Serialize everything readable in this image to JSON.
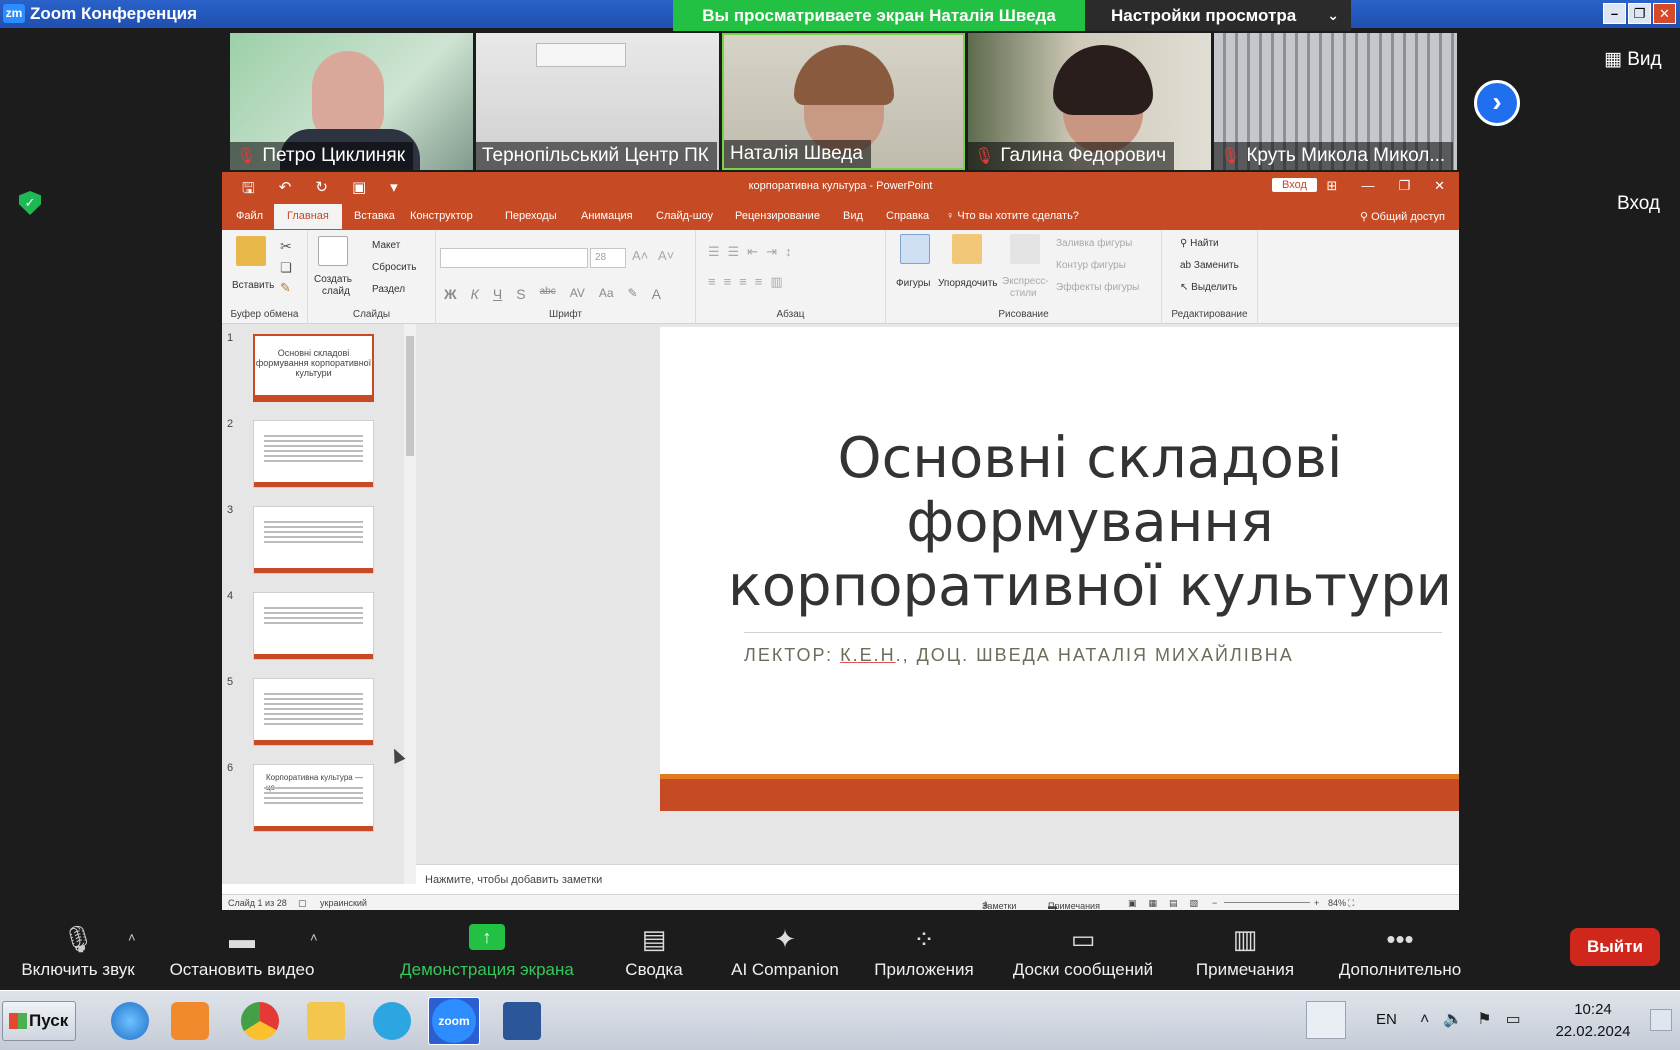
{
  "zoom": {
    "app_title": "Zoom Конференция",
    "logo_text": "zm",
    "viewing_banner": "Вы просматриваете экран Наталія Шведа",
    "view_options": "Настройки просмотра",
    "view_button": "Вид",
    "login_right": "Вход",
    "participants": [
      {
        "name": "Петро Циклиняк",
        "muted": true
      },
      {
        "name": "Тернопільський Центр ПК",
        "muted": false
      },
      {
        "name": "Наталія Шведа",
        "muted": false
      },
      {
        "name": "Галина Федорович",
        "muted": true
      },
      {
        "name": "Круть Микола Микол...",
        "muted": true
      }
    ],
    "toolbar": {
      "mute": "Включить звук",
      "video": "Остановить видео",
      "share": "Демонстрация экрана",
      "summary": "Сводка",
      "ai": "AI Companion",
      "apps": "Приложения",
      "boards": "Доски сообщений",
      "notes": "Примечания",
      "more": "Дополнительно",
      "leave": "Выйти"
    }
  },
  "ppt": {
    "title": "корпоративна культура  -  PowerPoint",
    "login": "Вход",
    "tabs": [
      "Файл",
      "Главная",
      "Вставка",
      "Конструктор",
      "Переходы",
      "Анимация",
      "Слайд-шоу",
      "Рецензирование",
      "Вид",
      "Справка"
    ],
    "tell_me": "Что вы хотите сделать?",
    "share": "Общий доступ",
    "ribbon": {
      "clipboard": {
        "label": "Буфер обмена",
        "paste": "Вставить"
      },
      "slides": {
        "label": "Слайды",
        "new_slide_1": "Создать",
        "new_slide_2": "слайд",
        "layout": "Макет",
        "reset": "Сбросить",
        "section": "Раздел"
      },
      "font": {
        "label": "Шрифт",
        "size": "28",
        "bold": "Ж",
        "italic": "К",
        "underline": "Ч",
        "strike": "S",
        "strike2": "abc",
        "spacing": "AV",
        "case": "Aa",
        "color": "A"
      },
      "paragraph": {
        "label": "Абзац"
      },
      "drawing": {
        "label": "Рисование",
        "shapes": "Фигуры",
        "arrange": "Упорядочить",
        "styles_1": "Экспресс-",
        "styles_2": "стили",
        "fill": "Заливка фигуры",
        "outline": "Контур фигуры",
        "effects": "Эффекты фигуры"
      },
      "editing": {
        "label": "Редактирование",
        "find": "Найти",
        "replace": "Заменить",
        "select": "Выделить"
      }
    },
    "slides": [
      {
        "num": "1",
        "title": "Основні складові формування корпоративної культури"
      },
      {
        "num": "2"
      },
      {
        "num": "3"
      },
      {
        "num": "4"
      },
      {
        "num": "5"
      },
      {
        "num": "6",
        "title": "Корпоративна культура — це"
      }
    ],
    "current_slide": {
      "title": "Основні складові формування корпоративної культури",
      "sub_prefix": "ЛЕКТОР: ",
      "sub_underlined": "К.Е.Н",
      "sub_rest": "., ДОЦ. ШВЕДА НАТАЛІЯ МИХАЙЛІВНА"
    },
    "notes_placeholder": "Нажмите, чтобы добавить заметки",
    "status": {
      "slide_of": "Слайд 1 из 28",
      "language": "украинский",
      "notes": "Заметки",
      "comments": "Примечания",
      "zoom": "84%"
    }
  },
  "taskbar": {
    "start": "Пуск",
    "lang": "EN",
    "time": "10:24",
    "date": "22.02.2024",
    "zoom_icon": "zoom"
  }
}
